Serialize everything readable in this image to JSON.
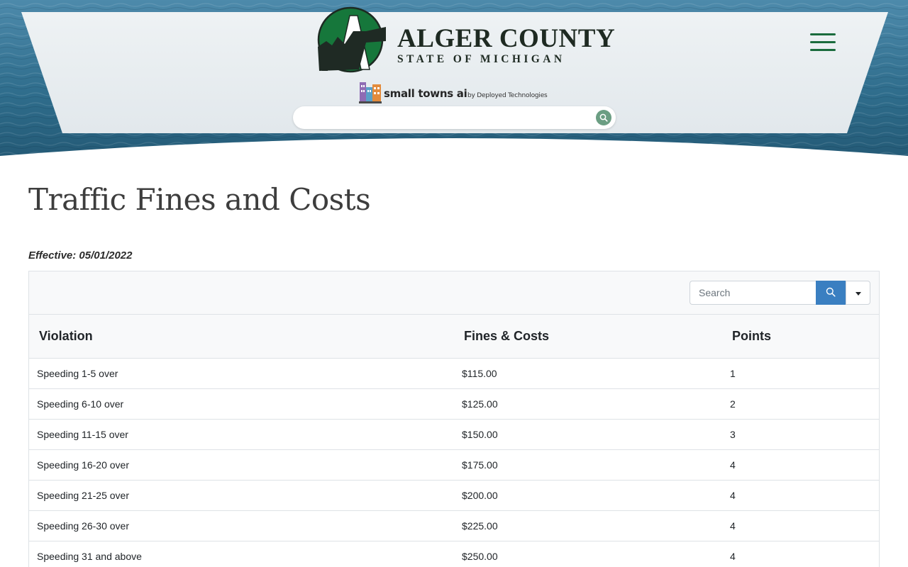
{
  "header": {
    "logo_title": "ALGER COUNTY",
    "logo_subtitle": "STATE OF MICHIGAN",
    "powered_by_name": "small towns ai",
    "powered_by_company": "by Deployed Technologies",
    "ai_search_placeholder": "",
    "menu_icon": "hamburger-icon",
    "search_icon": "search-icon",
    "colors": {
      "brand_green": "#1a6b3d",
      "water": "#2f6d8c",
      "panel": "#e9eef1"
    }
  },
  "page": {
    "title": "Traffic Fines and Costs",
    "effective": "Effective: 05/01/2022"
  },
  "table": {
    "search_placeholder": "Search",
    "search_button_icon": "search-icon",
    "dropdown_icon": "caret-down-icon",
    "accent_color": "#3a7fc1",
    "columns": [
      "Violation",
      "Fines & Costs",
      "Points"
    ],
    "rows": [
      [
        "Speeding 1-5 over",
        "$115.00",
        "1"
      ],
      [
        "Speeding 6-10 over",
        "$125.00",
        "2"
      ],
      [
        "Speeding 11-15 over",
        "$150.00",
        "3"
      ],
      [
        "Speeding 16-20 over",
        "$175.00",
        "4"
      ],
      [
        "Speeding 21-25 over",
        "$200.00",
        "4"
      ],
      [
        "Speeding 26-30 over",
        "$225.00",
        "4"
      ],
      [
        "Speeding 31 and above",
        "$250.00",
        "4"
      ]
    ]
  }
}
